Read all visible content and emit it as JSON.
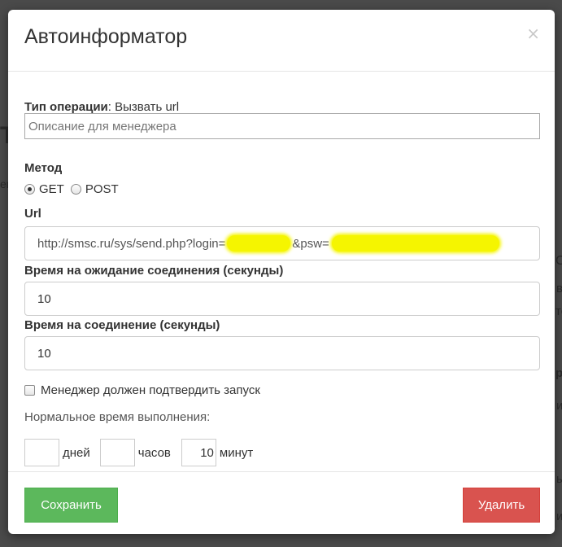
{
  "background": {
    "fragments": [
      "Т",
      "ем",
      "С",
      "в",
      "то",
      "ро",
      "и",
      "ы",
      "и"
    ]
  },
  "modal": {
    "title": "Автоинформатор",
    "close_icon": "×"
  },
  "form": {
    "operation_type_label": "Тип операции",
    "operation_type_sep": ":",
    "operation_type_value": " Вызвать url",
    "description_placeholder": "Описание для менеджера",
    "method_label": "Метод",
    "method_options": [
      "GET",
      "POST"
    ],
    "method_selected": "GET",
    "url_label": "Url",
    "url_value_prefix": "http://smsc.ru/sys/send.php?login=",
    "url_value_middle": "&psw=",
    "wait_timeout_label": "Время на ожидание соединения (секунды)",
    "wait_timeout_value": "10",
    "connect_timeout_label": "Время на соединение (секунды)",
    "connect_timeout_value": "10",
    "manager_confirm_label": "Менеджер должен подтвердить запуск",
    "manager_confirm_checked": false,
    "normal_time_label": "Нормальное время выполнения:",
    "days_value": "",
    "days_label": "дней",
    "hours_value": "",
    "hours_label": "часов",
    "minutes_value": "10",
    "minutes_label": "минут"
  },
  "footer": {
    "save_label": "Сохранить",
    "delete_label": "Удалить"
  },
  "colors": {
    "save": "#5cb85c",
    "delete": "#d9534f",
    "highlight": "#f5f500"
  }
}
